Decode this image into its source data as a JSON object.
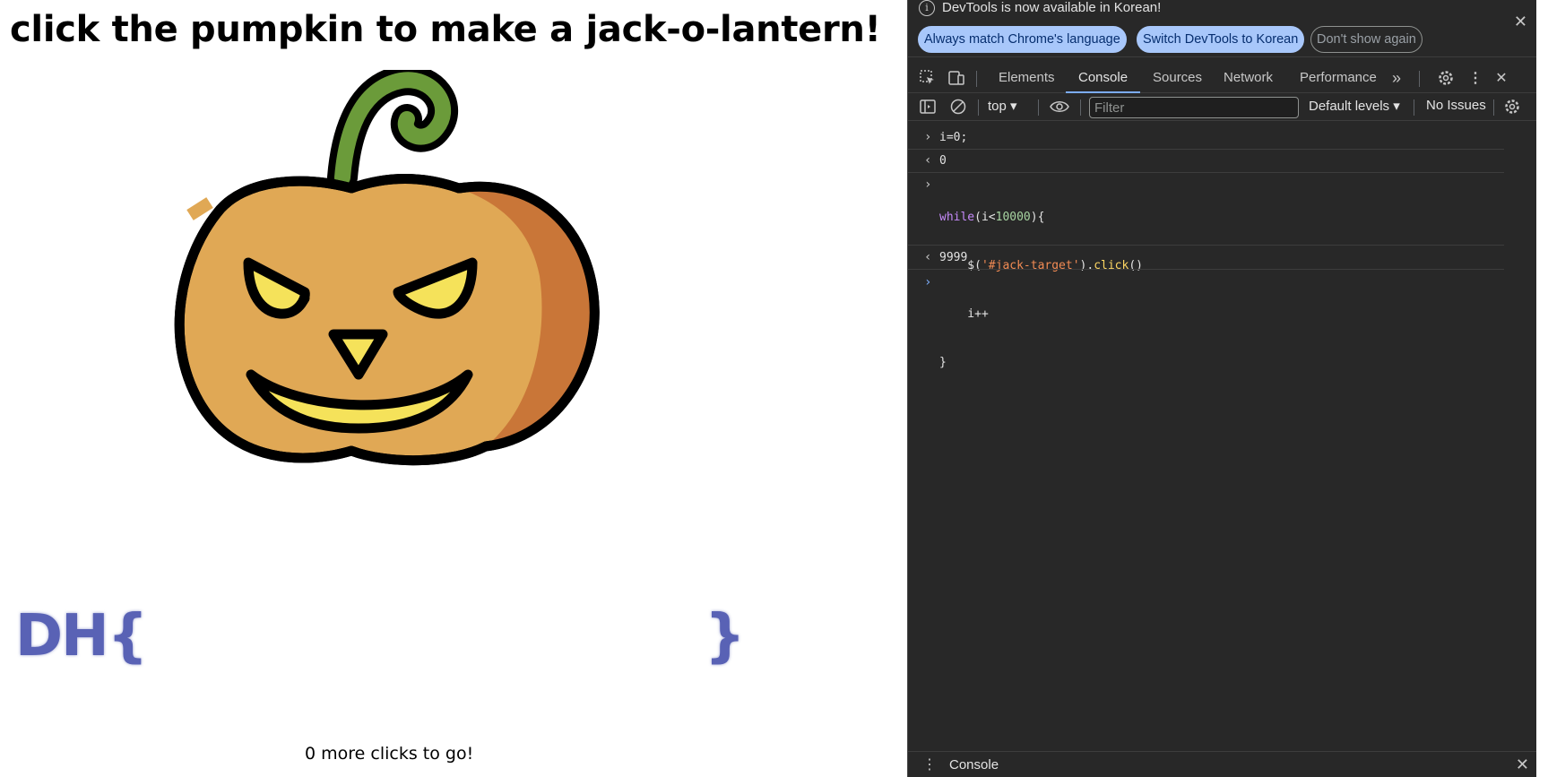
{
  "page": {
    "title": "click the pumpkin to make a jack-o-lantern!",
    "flag_prefix": "DH{",
    "flag_suffix": "}",
    "clicks_text": "0 more clicks to go!"
  },
  "devtools": {
    "infobar": {
      "message": "DevTools is now available in Korean!",
      "buttons": [
        "Always match Chrome's language",
        "Switch DevTools to Korean",
        "Don't show again"
      ]
    },
    "tabs": [
      "Elements",
      "Console",
      "Sources",
      "Network",
      "Performance"
    ],
    "active_tab": "Console",
    "toolbar": {
      "context": "top",
      "filter_placeholder": "Filter",
      "levels": "Default levels",
      "issues": "No Issues"
    },
    "console": {
      "entries": [
        {
          "kind": "input",
          "code": "i=0;"
        },
        {
          "kind": "output",
          "value": "0"
        },
        {
          "kind": "input",
          "lines": [
            "while(i<10000){",
            "    $('#jack-target').click()",
            "    i++",
            "}"
          ]
        },
        {
          "kind": "output",
          "value": "9999"
        }
      ]
    },
    "drawer": {
      "label": "Console"
    }
  },
  "colors": {
    "devtools_bg": "#282828",
    "accent_blue": "#a8c7fa",
    "flag_color": "#5962b5",
    "pumpkin_body": "#e0a855",
    "pumpkin_shade": "#c97638",
    "stem": "#6b9b3a",
    "eyes": "#f5e25a"
  }
}
